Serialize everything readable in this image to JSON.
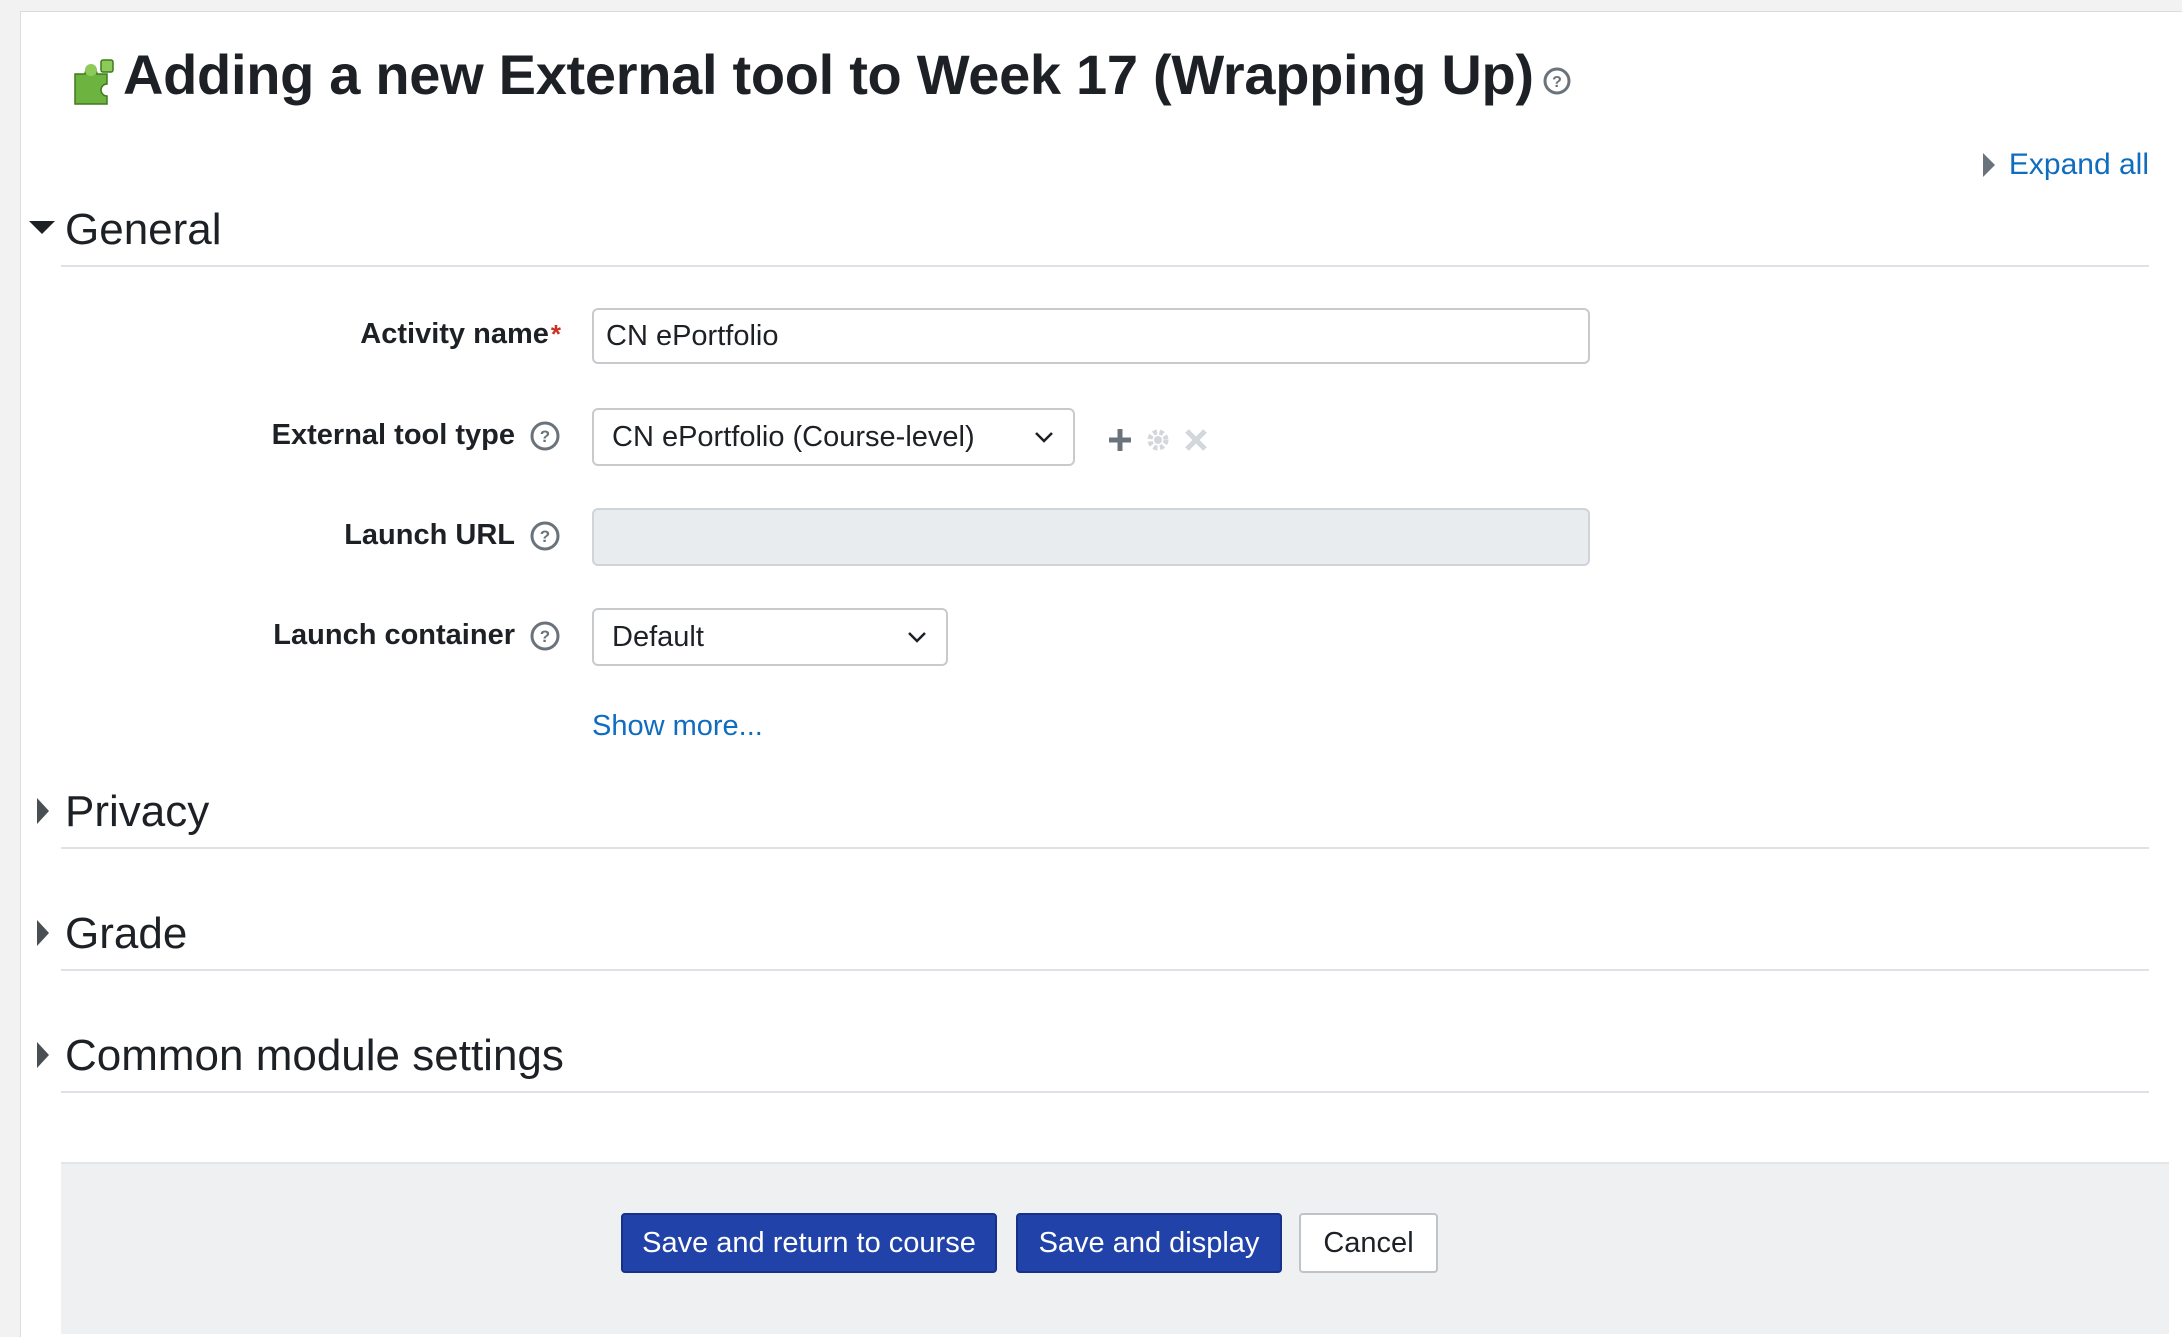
{
  "header": {
    "title": "Adding a new External tool to Week 17 (Wrapping Up)",
    "expand_all": "Expand all"
  },
  "sections": {
    "general": "General",
    "privacy": "Privacy",
    "grade": "Grade",
    "common": "Common module settings"
  },
  "form": {
    "activity_name_label": "Activity name",
    "activity_name_value": "CN ePortfolio",
    "required_mark": "*",
    "tool_type_label": "External tool type",
    "tool_type_value": "CN ePortfolio (Course-level)",
    "launch_url_label": "Launch URL",
    "launch_url_value": "",
    "launch_container_label": "Launch container",
    "launch_container_value": "Default",
    "show_more": "Show more..."
  },
  "buttons": {
    "save_return": "Save and return to course",
    "save_display": "Save and display",
    "cancel": "Cancel"
  },
  "colors": {
    "link": "#0f6cbf",
    "primary_button": "#2142a8",
    "required": "#ca3120",
    "puzzle_icon": "#6db33f"
  }
}
